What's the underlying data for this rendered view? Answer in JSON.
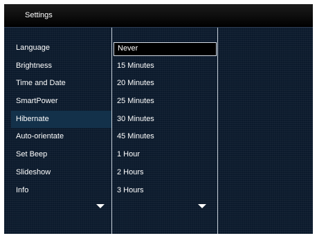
{
  "header": {
    "title": "Settings"
  },
  "menu": {
    "items": [
      {
        "label": "Language"
      },
      {
        "label": "Brightness"
      },
      {
        "label": "Time and Date"
      },
      {
        "label": "SmartPower"
      },
      {
        "label": "Hibernate"
      },
      {
        "label": "Auto-orientate"
      },
      {
        "label": "Set Beep"
      },
      {
        "label": "Slideshow"
      },
      {
        "label": "Info"
      }
    ],
    "active_index": 4
  },
  "options": {
    "items": [
      {
        "label": "Never"
      },
      {
        "label": "15 Minutes"
      },
      {
        "label": "20 Minutes"
      },
      {
        "label": "25 Minutes"
      },
      {
        "label": "30 Minutes"
      },
      {
        "label": "45 Minutes"
      },
      {
        "label": "1 Hour"
      },
      {
        "label": "2 Hours"
      },
      {
        "label": "3 Hours"
      }
    ],
    "selected_index": 0
  },
  "icons": {
    "menu_scroll": "chevron-down-icon",
    "options_scroll": "chevron-down-icon"
  },
  "colors": {
    "background": "#0b1a2c",
    "header": "#000000",
    "text": "#ffffff",
    "highlight": "#13314a"
  }
}
